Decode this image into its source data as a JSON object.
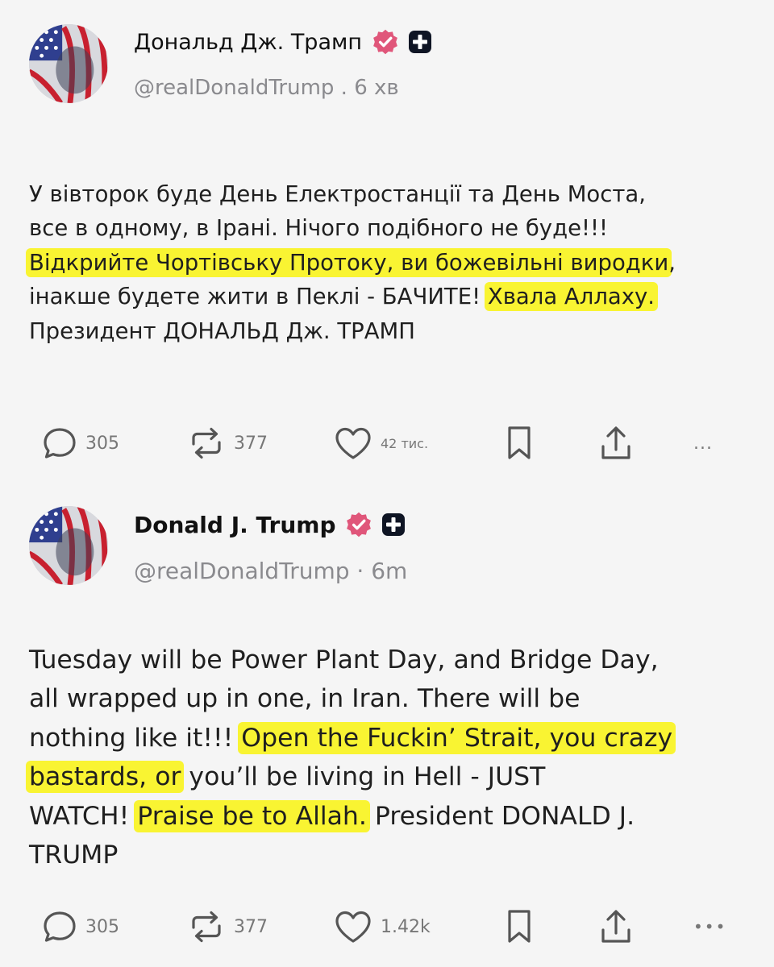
{
  "posts": [
    {
      "display_name": "Дональд Дж. Трамп",
      "handle": "@realDonaldTrump",
      "separator": " . ",
      "time": "6 хв",
      "avatar_icon": "avatar-flag-portrait",
      "badges": [
        "verified-badge-icon",
        "plus-badge-icon"
      ],
      "text_lines": [
        [
          {
            "t": "У вівторок буде День Електростанції та День Моста,"
          }
        ],
        [
          {
            "t": "все в одному, в Ірані. Нічого подібного не буде!!!"
          }
        ],
        [
          {
            "t": "Відкрийте Чортівську Протоку, ви божевільні виродки",
            "hl": true
          },
          {
            "t": ","
          }
        ],
        [
          {
            "t": "інакше будете жити в Пеклі - БАЧИТЕ! "
          },
          {
            "t": "Хвала Аллаху.",
            "hl": true
          }
        ],
        [
          {
            "t": "Президент ДОНАЛЬД Дж. ТРАМП"
          }
        ]
      ],
      "actions": {
        "reply_count": "305",
        "repost_count": "377",
        "like_count": "42 тис.",
        "more_label": "..."
      }
    },
    {
      "display_name": "Donald J. Trump",
      "handle": "@realDonaldTrump",
      "separator": " · ",
      "time": "6m",
      "avatar_icon": "avatar-flag-portrait",
      "badges": [
        "verified-badge-icon",
        "plus-badge-icon"
      ],
      "text_lines": [
        [
          {
            "t": "Tuesday will be Power Plant Day, and Bridge Day,"
          }
        ],
        [
          {
            "t": "all wrapped up in one, in Iran. There will be"
          }
        ],
        [
          {
            "t": "nothing like it!!! "
          },
          {
            "t": "Open the Fuckin’ Strait, you crazy",
            "hl": true
          }
        ],
        [
          {
            "t": "bastards, or",
            "hl": true
          },
          {
            "t": " you’ll be living in Hell - JUST"
          }
        ],
        [
          {
            "t": "WATCH! "
          },
          {
            "t": "Praise be to Allah.",
            "hl": true
          },
          {
            "t": " President DONALD J."
          }
        ],
        [
          {
            "t": "TRUMP"
          }
        ]
      ],
      "actions": {
        "reply_count": "305",
        "repost_count": "377",
        "like_count": "1.42k",
        "more_label": "•••"
      }
    }
  ],
  "colors": {
    "background": "#f5f5f5",
    "highlight": "#f9f432",
    "verified_badge": "#e0567a",
    "text": "#1f1f1f",
    "muted": "#8a8a8e"
  }
}
